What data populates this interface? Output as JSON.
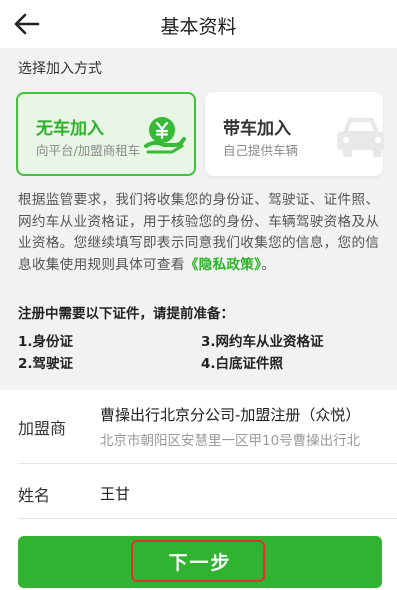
{
  "header": {
    "title": "基本资料",
    "back_icon": "back-arrow-icon"
  },
  "join": {
    "section_label": "选择加入方式",
    "options": [
      {
        "title": "无车加入",
        "subtitle": "向平台/加盟商租车",
        "selected": true,
        "icon": "yen-hand-icon"
      },
      {
        "title": "带车加入",
        "subtitle": "自己提供车辆",
        "selected": false,
        "icon": "car-icon"
      }
    ]
  },
  "notice": {
    "text": "根据监管要求，我们将收集您的身份证、驾驶证、证件照、网约车从业资格证，用于核验您的身份、车辆驾驶资格及从业资格。您继续填写即表示同意我们收集您的信息，您的信息收集使用规则具体可查看",
    "link": "《隐私政策》",
    "tail": "。"
  },
  "requirements": {
    "title": "注册中需要以下证件，请提前准备：",
    "items": [
      "1.身份证",
      "3.网约车从业资格证",
      "2.驾驶证",
      "4.白底证件照"
    ]
  },
  "form": {
    "franchise_label": "加盟商",
    "franchise_name": "曹操出行北京分公司-加盟注册（众悦）",
    "franchise_address": "北京市朝阳区安慧里一区甲10号曹操出行北",
    "name_label": "姓名",
    "name_value": "王甘"
  },
  "next_button": {
    "label": "下一步"
  },
  "colors": {
    "accent": "#2fb330",
    "highlight": "#e0322f",
    "selected_bg": "#e8f6e6"
  }
}
